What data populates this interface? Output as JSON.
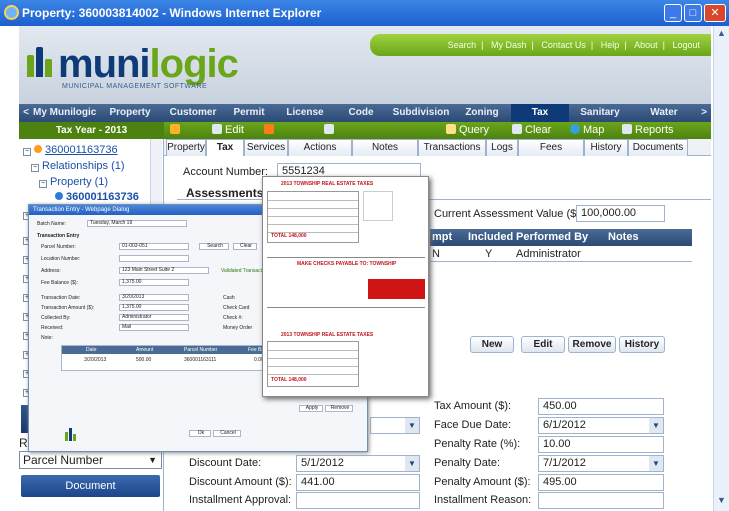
{
  "window": {
    "title": "Property: 360003814002 - Windows Internet Explorer",
    "minimize": "_",
    "maximize": "□",
    "close": "✕"
  },
  "top_links": [
    "Search",
    "My Dash",
    "Contact Us",
    "Help",
    "About",
    "Logout"
  ],
  "brand": {
    "part1": "muni",
    "part2": "logic",
    "tagline": "MUNICIPAL MANAGEMENT SOFTWARE",
    "colors": {
      "navy": "#0e3a78",
      "green": "#6aa51a"
    }
  },
  "nav": {
    "items": [
      "My Munilogic",
      "Property",
      "Customer",
      "Permit",
      "License",
      "Code",
      "Subdivision",
      "Zoning",
      "Tax",
      "Sanitary",
      "Water"
    ],
    "active": "Tax",
    "prev": "<",
    "next": ">"
  },
  "toolbar": {
    "tax_year": "Tax Year - 2013",
    "edit": "Edit",
    "query": "Query",
    "clear": "Clear",
    "map": "Map",
    "reports": "Reports"
  },
  "tree": {
    "root": "360001163736",
    "relationships": "Relationships (1)",
    "property": "Property (1)",
    "property_id": "360001163736",
    "partial_items": [
      "3",
      "3",
      "3",
      "3",
      "3",
      "3",
      "3",
      "3",
      "3",
      "3"
    ]
  },
  "left": {
    "record": "Record",
    "parcel_select": "Parcel Number",
    "document_button": "Document"
  },
  "subtabs": [
    "Property",
    "Tax",
    "Services",
    "Actions",
    "Notes",
    "Transactions",
    "Logs",
    "Fees",
    "History",
    "Documents"
  ],
  "content": {
    "account_label": "Account Number:",
    "account_value": "5551234",
    "assessments_title": "Assessments",
    "current_assessment_label": "Current Assessment Value ($):",
    "current_assessment_value": "100,000.00",
    "table_headers": [
      "mpt",
      "Included",
      "Performed By",
      "Notes"
    ],
    "table_row": [
      "N",
      "Y",
      "Administrator",
      ""
    ],
    "buttons": [
      "New",
      "Edit",
      "Remove",
      "History"
    ],
    "tax_amount_label": "Tax Amount ($):",
    "tax_amount_value": "450.00",
    "face_due_label": "Face Due Date:",
    "face_due_value": "6/1/2012",
    "penalty_rate_label": "Penalty Rate (%):",
    "penalty_rate_value": "10.00",
    "penalty_date_label": "Penalty Date:",
    "penalty_date_value": "7/1/2012",
    "penalty_amount_label": "Penalty Amount ($):",
    "penalty_amount_value": "495.00",
    "installment_reason_label": "Installment Reason:",
    "discount_date_label": "Discount Date:",
    "discount_date_value": "5/1/2012",
    "discount_amount_label": "Discount Amount ($):",
    "discount_amount_value": "441.00",
    "installment_approval_label": "Installment Approval:"
  },
  "transaction_dialog": {
    "title": "Transaction Entry - Webpage Dialog",
    "batch_label": "Batch Name:",
    "batch_value": "Tuesday, March 19",
    "section": "Transaction Entry",
    "parcel_label": "Parcel Number:",
    "parcel_value": "01-003-051",
    "search_button": "Search",
    "clear_button": "Clear",
    "location_label": "Location Number:",
    "address_label": "Address:",
    "address_value": "123 Main Street Suite 2",
    "validated": "Validated Transaction",
    "fee_balance_label": "Fee Balance ($):",
    "fee_balance_value": "1,375.00",
    "date_label": "Transaction Date:",
    "date_value": "3/20/2013",
    "cash": "Cash",
    "amount_label": "Transaction Amount ($):",
    "amount_value": "1,375.00",
    "check_card": "Check Card",
    "collected_label": "Collected By:",
    "collected_value": "Administrator",
    "check_no": "Check #:",
    "received_label": "Received:",
    "received_value": "Mail",
    "money_order": "Money Order",
    "note_label": "Note:",
    "grid_headers": [
      "Date",
      "Amount",
      "Parcel Number",
      "Fee Balance"
    ],
    "grid_row": [
      "3/20/2013",
      "500.00",
      "360001163111",
      "0.00"
    ],
    "apply": "Apply",
    "remove": "Remove",
    "ok": "Ok",
    "cancel": "Cancel"
  },
  "tax_bill": {
    "heading1": "2013 TOWNSHIP REAL ESTATE TAXES",
    "heading2": "MAKE CHECKS PAYABLE TO: TOWNSHIP",
    "heading3": "2013 TOWNSHIP REAL ESTATE TAXES",
    "total1": "TOTAL 148,000",
    "total2": "TOTAL 148,000"
  }
}
